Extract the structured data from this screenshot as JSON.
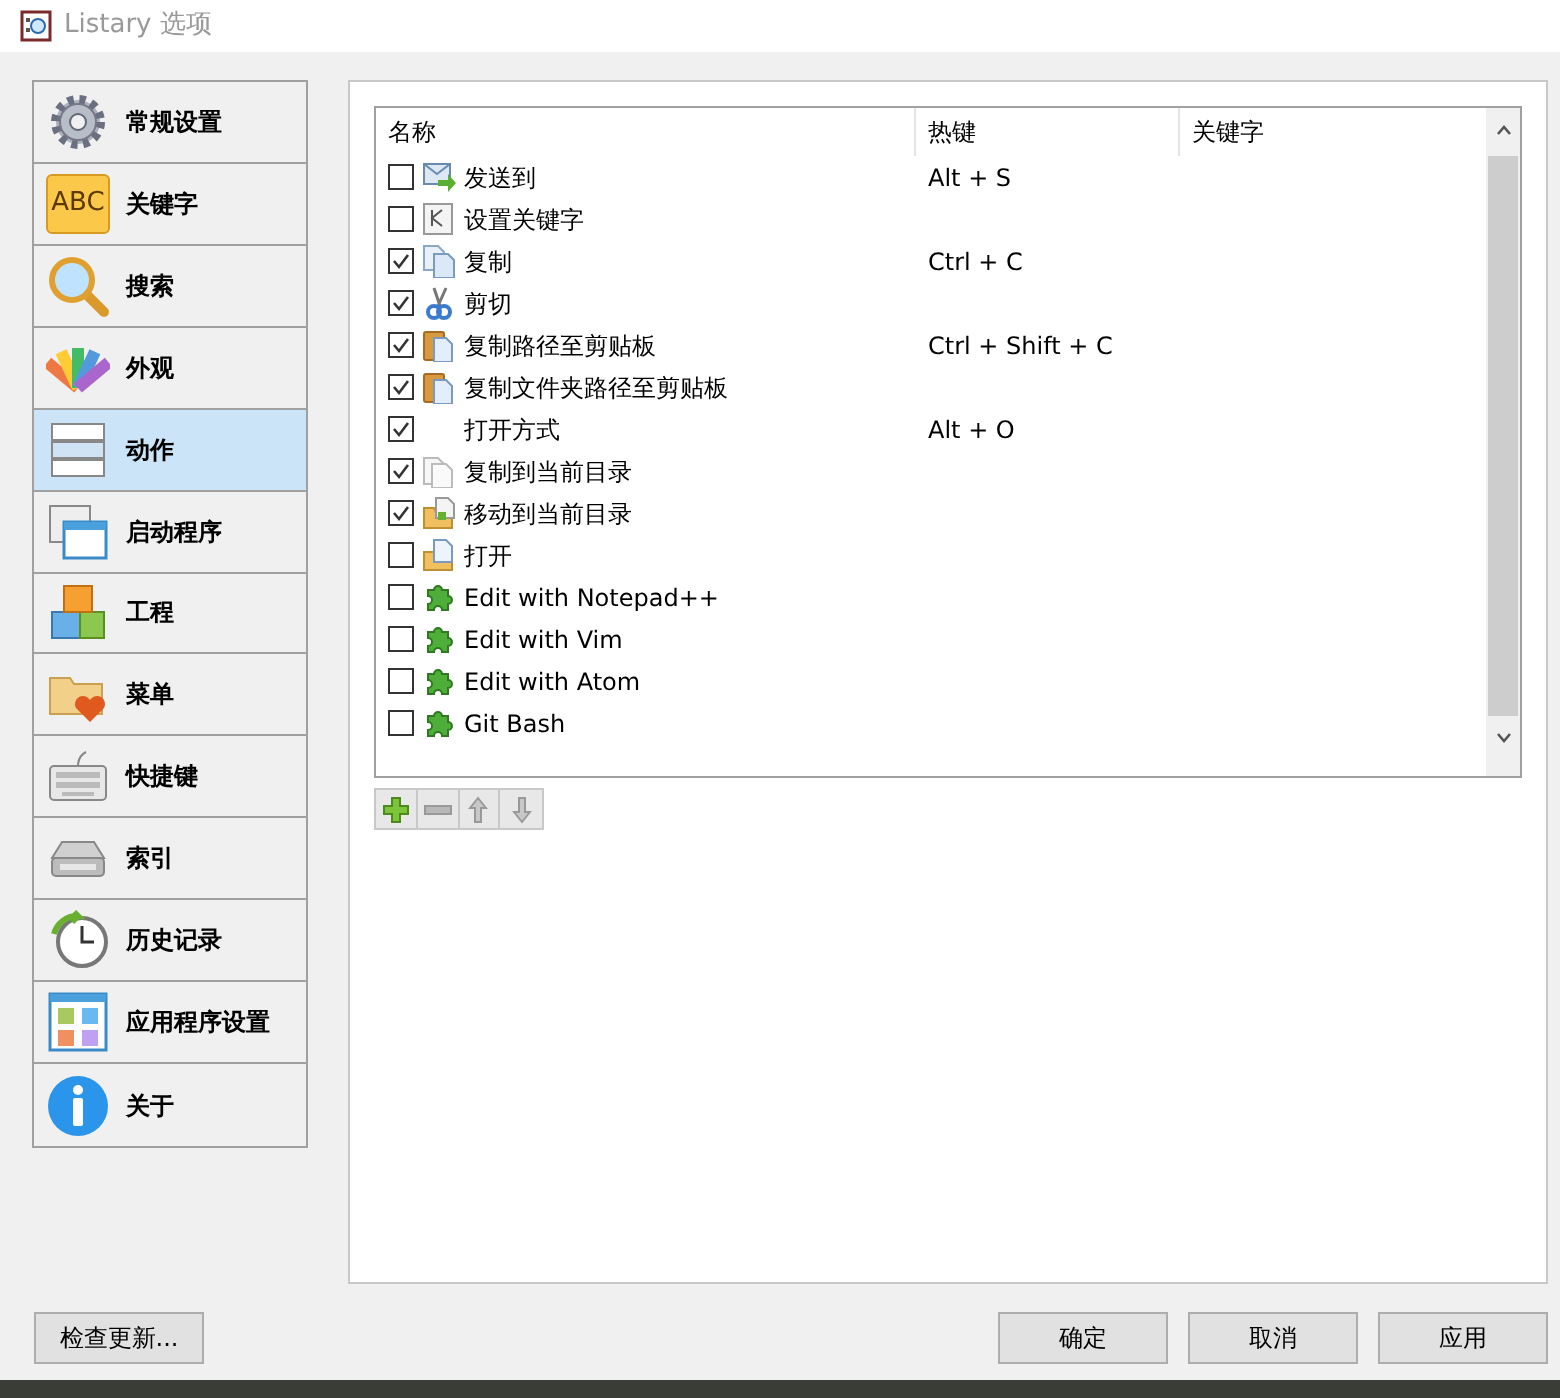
{
  "window": {
    "title": "Listary 选项"
  },
  "sidebar": {
    "items": [
      {
        "label": "常规设置",
        "selected": false
      },
      {
        "label": "关键字",
        "selected": false
      },
      {
        "label": "搜索",
        "selected": false
      },
      {
        "label": "外观",
        "selected": false
      },
      {
        "label": "动作",
        "selected": true
      },
      {
        "label": "启动程序",
        "selected": false
      },
      {
        "label": "工程",
        "selected": false
      },
      {
        "label": "菜单",
        "selected": false
      },
      {
        "label": "快捷键",
        "selected": false
      },
      {
        "label": "索引",
        "selected": false
      },
      {
        "label": "历史记录",
        "selected": false
      },
      {
        "label": "应用程序设置",
        "selected": false
      },
      {
        "label": "关于",
        "selected": false
      }
    ]
  },
  "sidebar_icon_text": "ABC",
  "table": {
    "columns": [
      "名称",
      "热键",
      "关键字"
    ],
    "rows": [
      {
        "name": "发送到",
        "hotkey": "Alt + S",
        "checked": false
      },
      {
        "name": "设置关键字",
        "checked": false
      },
      {
        "name": "复制",
        "hotkey": "Ctrl + C",
        "checked": true
      },
      {
        "name": "剪切",
        "checked": true
      },
      {
        "name": "复制路径至剪贴板",
        "hotkey": "Ctrl + Shift + C",
        "checked": true
      },
      {
        "name": "复制文件夹路径至剪贴板",
        "checked": true
      },
      {
        "name": "打开方式",
        "hotkey": "Alt + O",
        "checked": true
      },
      {
        "name": "复制到当前目录",
        "checked": true
      },
      {
        "name": "移动到当前目录",
        "checked": true
      },
      {
        "name": "打开",
        "checked": false
      },
      {
        "name": "Edit with Notepad++",
        "checked": false
      },
      {
        "name": "Edit with Vim",
        "checked": false
      },
      {
        "name": "Edit with Atom",
        "checked": false
      },
      {
        "name": "Git Bash",
        "checked": false
      }
    ]
  },
  "footer": {
    "update_button": "检查更新...",
    "buttons": [
      "确定",
      "取消",
      "应用"
    ]
  }
}
